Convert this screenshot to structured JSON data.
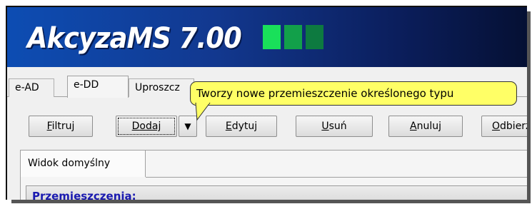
{
  "app": {
    "title": "AkcyzaMS 7.00"
  },
  "tabs": [
    {
      "label": "e-AD",
      "active": false
    },
    {
      "label": "e-DD",
      "active": true
    },
    {
      "label": "Uproszcz",
      "active": false
    }
  ],
  "toolbar": {
    "filtruj": {
      "pre": "",
      "key": "F",
      "post": "iltruj"
    },
    "dodaj": {
      "pre": "",
      "key": "D",
      "post": "odaj"
    },
    "dropdown_arrow": "▼",
    "edytuj": {
      "pre": "",
      "key": "E",
      "post": "dytuj"
    },
    "usun": {
      "pre": "",
      "key": "U",
      "post": "suń"
    },
    "anuluj": {
      "pre": "",
      "key": "A",
      "post": "nuluj"
    },
    "odbierz": {
      "pre": "",
      "key": "O",
      "post": "dbierz"
    }
  },
  "tooltip": {
    "text": "Tworzy nowe przemieszczenie określonego typu"
  },
  "view": {
    "tab_label": "Widok domyślny",
    "section_title": "Przemieszczenia:"
  },
  "colors": {
    "banner_start": "#0d4db3",
    "banner_end": "#051033",
    "block_1": "#19e05a",
    "block_2": "#12a04a",
    "block_3": "#0d7a40",
    "tooltip_bg": "#ffff66",
    "section_title": "#1a1ab0"
  }
}
